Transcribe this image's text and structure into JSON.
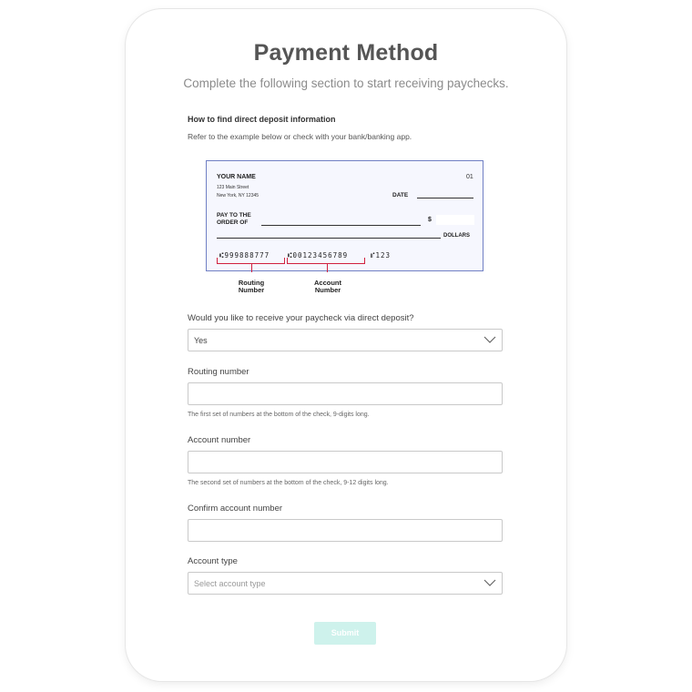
{
  "header": {
    "title": "Payment Method",
    "subtitle": "Complete the following section to start receiving paychecks."
  },
  "info": {
    "heading": "How to find direct deposit information",
    "text": "Refer to the example below or check with your bank/banking app."
  },
  "check_example": {
    "name": "YOUR NAME",
    "address_line1": "123 Main Street",
    "address_line2": "New York, NY 12345",
    "check_number": "01",
    "date_label": "DATE",
    "pay_to_line1": "PAY TO THE",
    "pay_to_line2": "ORDER OF",
    "dollar_sign": "$",
    "dollars_label": "DOLLARS",
    "routing_micr": "⑆999888777",
    "account_micr": "⑆00123456789",
    "check_micr": "⑈123",
    "routing_caption_1": "Routing",
    "routing_caption_2": "Number",
    "account_caption_1": "Account",
    "account_caption_2": "Number"
  },
  "form": {
    "deposit_question": "Would you like to receive your paycheck via direct deposit?",
    "deposit_value": "Yes",
    "routing_label": "Routing number",
    "routing_value": "",
    "routing_help": "The first set of numbers at the bottom of the check, 9-digits long.",
    "account_label": "Account number",
    "account_value": "",
    "account_help": "The second set of numbers at the bottom of the check, 9-12 digits long.",
    "confirm_label": "Confirm account number",
    "confirm_value": "",
    "account_type_label": "Account type",
    "account_type_placeholder": "Select account type",
    "submit_label": "Submit"
  },
  "colors": {
    "accent_disabled": "#cef2ec",
    "check_border": "#7080c4",
    "bracket": "#d0213f"
  },
  "icons": {
    "select_chevron": "chevron-down-icon"
  }
}
